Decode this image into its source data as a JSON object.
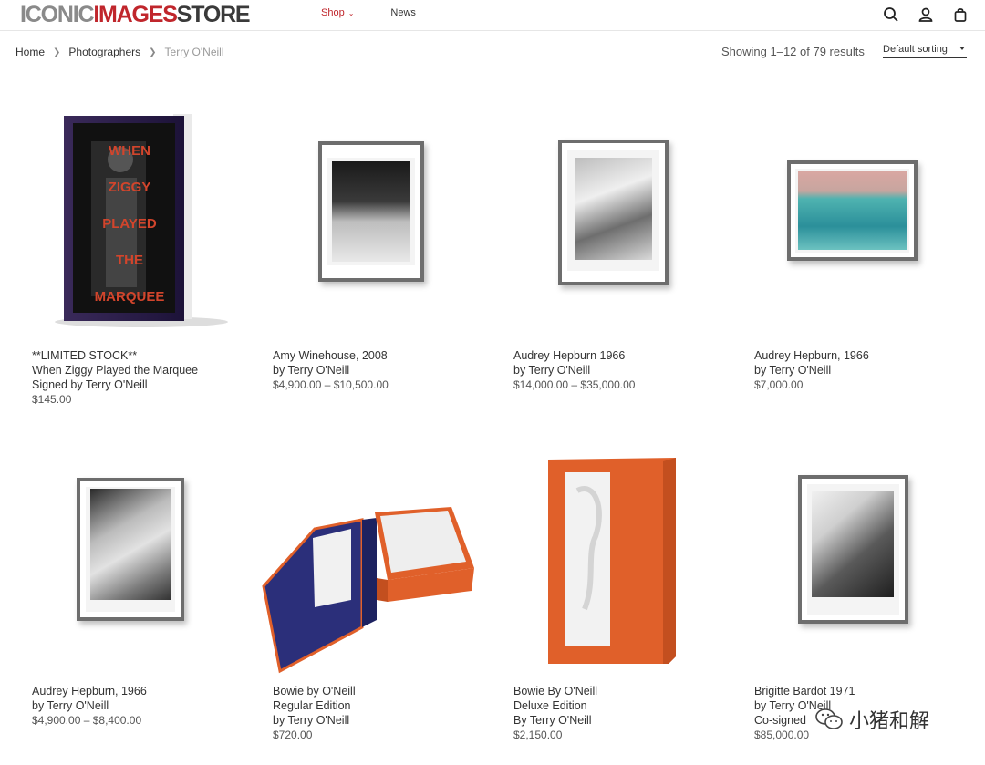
{
  "header": {
    "logo": {
      "part1": "ICONIC",
      "part2": "IMAGES",
      "part3": "STORE"
    },
    "nav": [
      {
        "label": "Shop",
        "has_dropdown": true,
        "active": true
      },
      {
        "label": "News",
        "has_dropdown": false,
        "active": false
      }
    ],
    "icons": [
      "search-icon",
      "account-icon",
      "cart-icon"
    ]
  },
  "breadcrumb": [
    "Home",
    "Photographers",
    "Terry O'Neill"
  ],
  "results_text": "Showing 1–12 of 79 results",
  "sorting": {
    "selected": "Default sorting"
  },
  "products": [
    {
      "lines": [
        "**LIMITED STOCK**",
        "When Ziggy Played the Marquee",
        "Signed by Terry O'Neill"
      ],
      "price": "$145.00",
      "image": "book-when-ziggy-played-the-marquee",
      "book_text": [
        "WHEN",
        "ZIGGY",
        "PLAYED",
        "THE",
        "MARQUEE"
      ]
    },
    {
      "lines": [
        "Amy Winehouse, 2008",
        "by Terry O'Neill"
      ],
      "price": "$4,900.00 – $10,500.00",
      "image": "framed-photo-amy-winehouse"
    },
    {
      "lines": [
        "Audrey Hepburn 1966",
        "by Terry O'Neill"
      ],
      "price": "$14,000.00 – $35,000.00",
      "image": "framed-photo-audrey-hepburn-doves"
    },
    {
      "lines": [
        "Audrey Hepburn, 1966",
        "by Terry O'Neill"
      ],
      "price": "$7,000.00",
      "image": "framed-photo-audrey-hepburn-pool"
    },
    {
      "lines": [
        "Audrey Hepburn, 1966",
        "by Terry O'Neill"
      ],
      "price": "$4,900.00 – $8,400.00",
      "image": "framed-photo-audrey-hepburn-hat"
    },
    {
      "lines": [
        "Bowie by O'Neill",
        "Regular Edition",
        "by Terry O'Neill"
      ],
      "price": "$720.00",
      "image": "book-box-bowie-regular"
    },
    {
      "lines": [
        "Bowie By O'Neill",
        "Deluxe Edition",
        "By Terry O'Neill"
      ],
      "price": "$2,150.00",
      "image": "book-box-bowie-deluxe"
    },
    {
      "lines": [
        "Brigitte Bardot 1971",
        "by Terry O'Neill",
        "Co-signed"
      ],
      "price": "$85,000.00",
      "image": "framed-photo-brigitte-bardot"
    }
  ],
  "watermark": {
    "text": "小猪和解",
    "icon": "wechat-icon"
  },
  "colors": {
    "brand_red": "#c0262c",
    "logo_gray": "#8a8a8a",
    "logo_dark": "#3a3a3a",
    "orange": "#e0602a",
    "navy": "#2b2f7a"
  }
}
